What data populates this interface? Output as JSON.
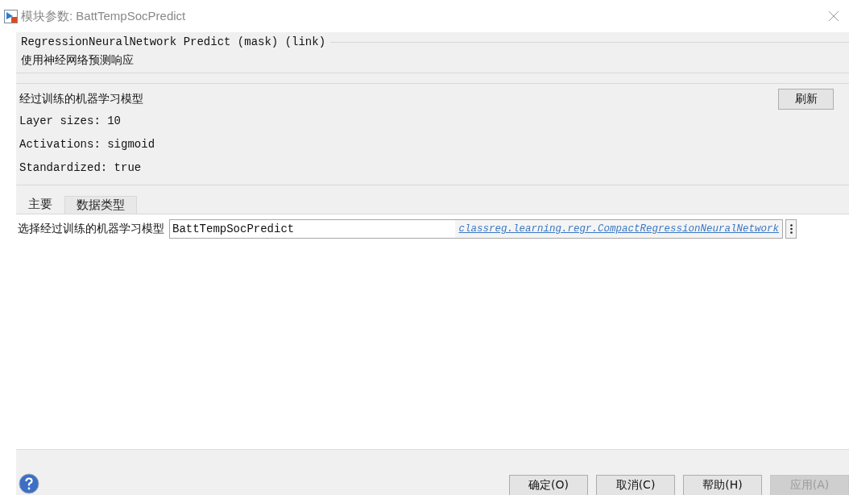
{
  "window": {
    "title": "模块参数: BattTempSocPredict"
  },
  "block": {
    "heading": "RegressionNeuralNetwork Predict (mask) (link)",
    "description": "使用神经网络预测响应"
  },
  "model": {
    "title": "经过训练的机器学习模型",
    "refresh_button": "刷新",
    "details": [
      "Layer sizes: 10",
      "Activations: sigmoid",
      "Standardized: true"
    ]
  },
  "tabs": [
    {
      "label": "主要",
      "selected": true
    },
    {
      "label": "数据类型",
      "selected": false
    }
  ],
  "model_field": {
    "label": "选择经过训练的机器学习模型",
    "value": "BattTempSocPredict",
    "type_link": "classreg.learning.regr.CompactRegressionNeuralNetwork"
  },
  "buttons": [
    {
      "label": "确定(O)",
      "disabled": false
    },
    {
      "label": "取消(C)",
      "disabled": false
    },
    {
      "label": "帮助(H)",
      "disabled": false
    },
    {
      "label": "应用(A)",
      "disabled": true
    }
  ]
}
